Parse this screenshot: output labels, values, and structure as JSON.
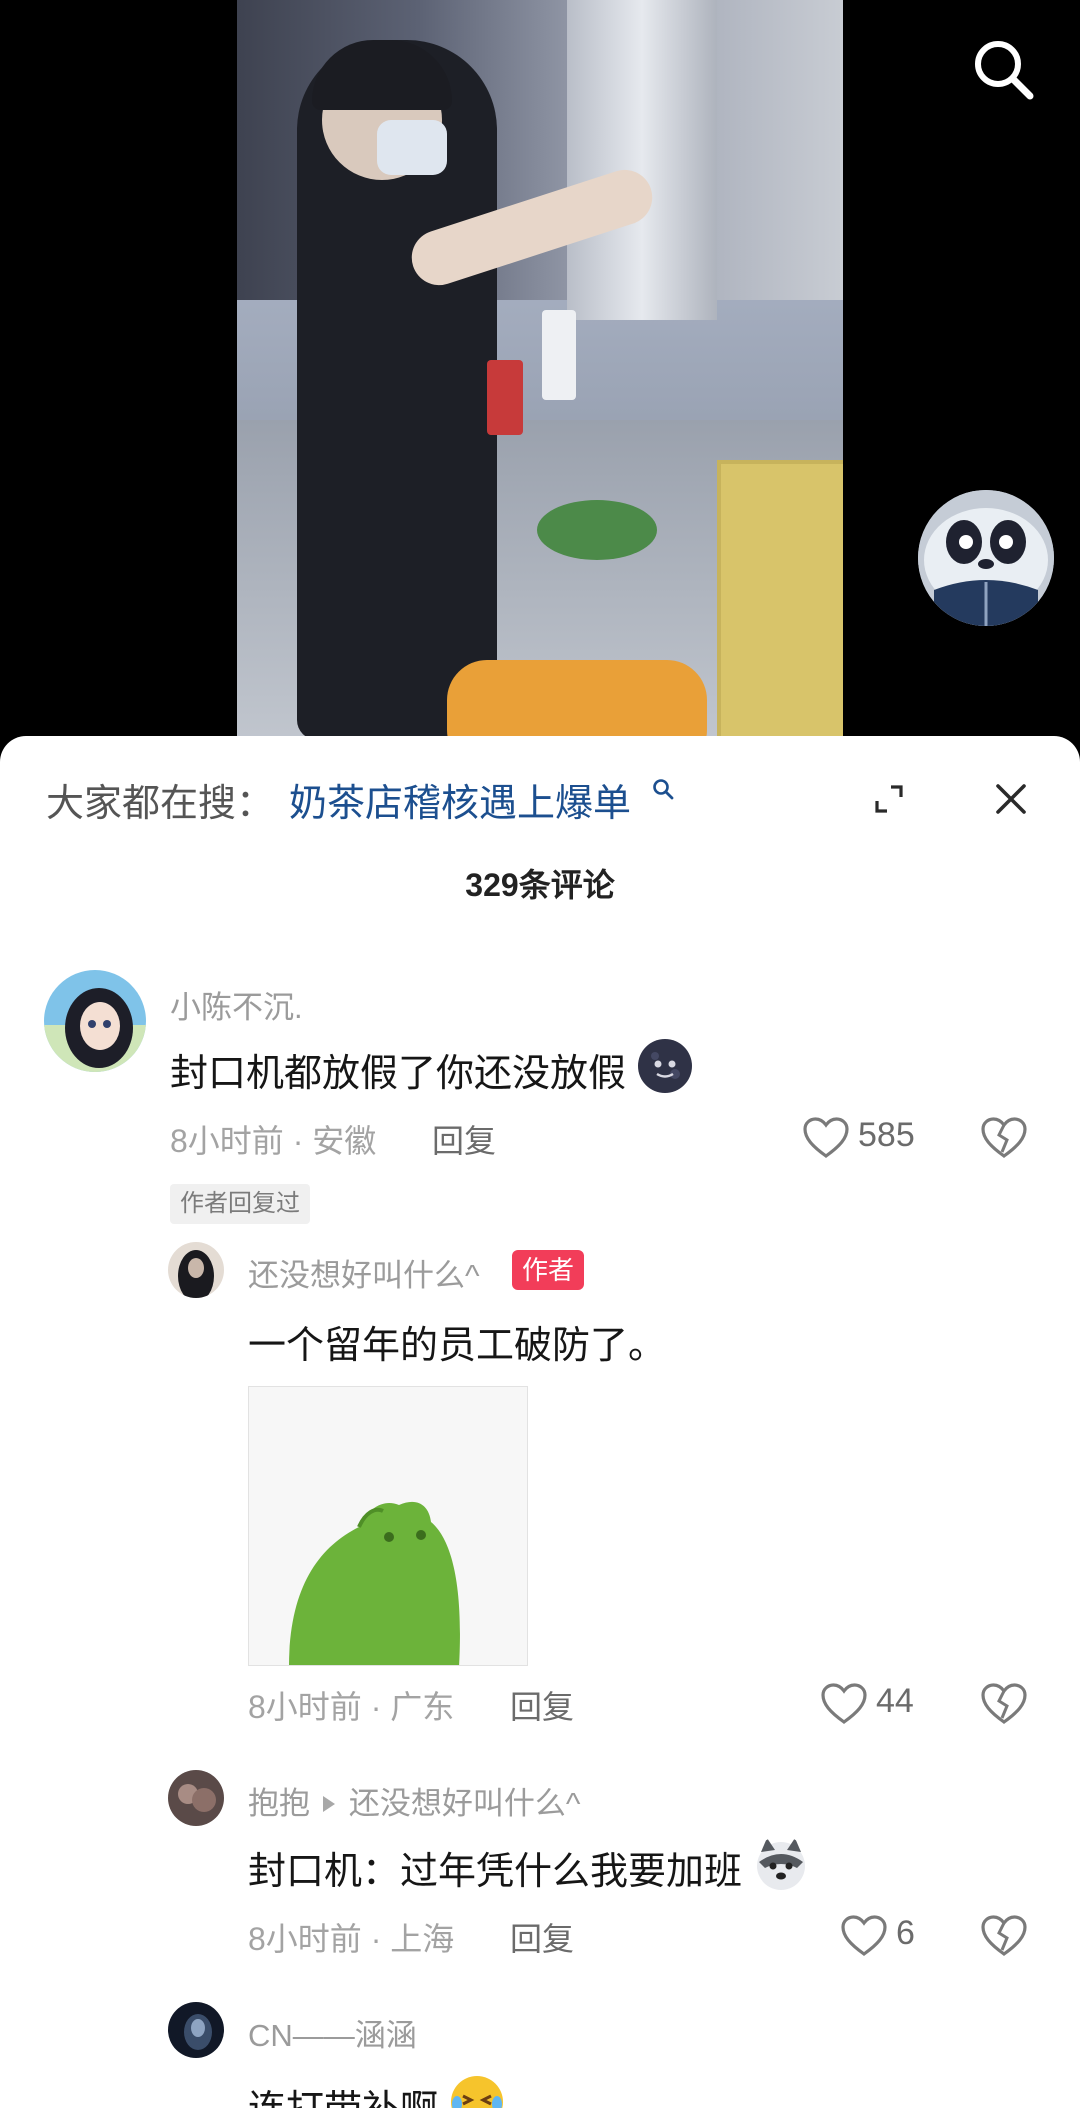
{
  "video": {},
  "sheet": {
    "hot_prefix": "大家都在搜：",
    "hot_term": "奶茶店稽核遇上爆单",
    "comment_count": "329条评论"
  },
  "comments": [
    {
      "user": "小陈不沉.",
      "text": "封口机都放假了你还没放假",
      "time_loc": "8小时前 · 安徽",
      "reply": "回复",
      "likes": "585",
      "author_replied": "作者回复过"
    },
    {
      "user": "还没想好叫什么^",
      "author_tag": "作者",
      "text": "一个留年的员工破防了。",
      "time_loc": "8小时前 · 广东",
      "reply": "回复",
      "likes": "44"
    },
    {
      "user": "抱抱",
      "reply_to": "还没想好叫什么^",
      "text": "封口机：过年凭什么我要加班",
      "time_loc": "8小时前 · 上海",
      "reply": "回复",
      "likes": "6"
    },
    {
      "user": "CN——涵涵",
      "text": "连打带补啊"
    }
  ],
  "colors": {
    "hot_term": "#1c4f8f",
    "author_tag": "#f23d59"
  }
}
